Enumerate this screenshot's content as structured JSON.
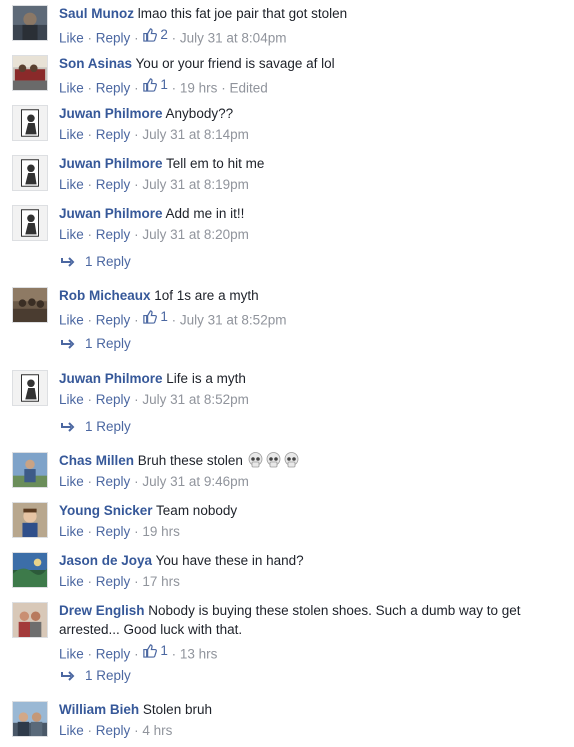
{
  "actions": {
    "like": "Like",
    "reply": "Reply",
    "separator": "·"
  },
  "comments": [
    {
      "author": "Saul Munoz",
      "text": "lmao this fat joe pair that got stolen",
      "likes": "2",
      "time": "July 31 at 8:04pm",
      "edited": ""
    },
    {
      "author": "Son Asinas",
      "text": "You or your friend is savage af lol",
      "likes": "1",
      "time": "19 hrs",
      "edited": "Edited"
    },
    {
      "author": "Juwan Philmore",
      "text": "Anybody??",
      "likes": "",
      "time": "July 31 at 8:14pm",
      "edited": ""
    },
    {
      "author": "Juwan Philmore",
      "text": "Tell em to hit me",
      "likes": "",
      "time": "July 31 at 8:19pm",
      "edited": ""
    },
    {
      "author": "Juwan Philmore",
      "text": "Add me in it!!",
      "likes": "",
      "time": "July 31 at 8:20pm",
      "edited": "",
      "replies": "1 Reply"
    },
    {
      "author": "Rob Micheaux",
      "text": "1of 1s are a myth",
      "likes": "1",
      "time": "July 31 at 8:52pm",
      "edited": "",
      "replies": "1 Reply"
    },
    {
      "author": "Juwan Philmore",
      "text": "Life is a myth",
      "likes": "",
      "time": "July 31 at 8:52pm",
      "edited": "",
      "replies": "1 Reply"
    },
    {
      "author": "Chas Millen",
      "text": "Bruh these stolen",
      "likes": "",
      "time": "July 31 at 9:46pm",
      "edited": ""
    },
    {
      "author": "Young Snicker",
      "text": "Team nobody",
      "likes": "",
      "time": "19 hrs",
      "edited": ""
    },
    {
      "author": "Jason de Joya",
      "text": "You have these in hand?",
      "likes": "",
      "time": "17 hrs",
      "edited": ""
    },
    {
      "author": "Drew English",
      "text": "Nobody is buying these stolen shoes. Such a dumb way to get arrested... Good luck with that.",
      "likes": "1",
      "time": "13 hrs",
      "edited": "",
      "replies": "1 Reply"
    },
    {
      "author": "William Bieh",
      "text": "Stolen bruh",
      "likes": "",
      "time": "4 hrs",
      "edited": ""
    }
  ],
  "colors": {
    "author": "#365899",
    "link": "#4b67a1",
    "meta": "#90949c",
    "text": "#1d2129"
  }
}
